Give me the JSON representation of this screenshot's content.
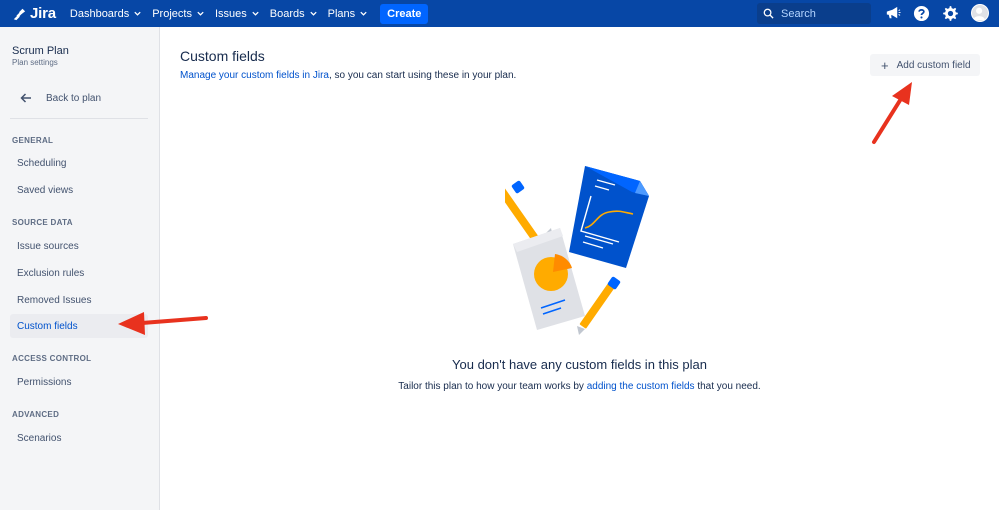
{
  "topnav": {
    "logo_text": "Jira",
    "items": [
      {
        "label": "Dashboards"
      },
      {
        "label": "Projects"
      },
      {
        "label": "Issues"
      },
      {
        "label": "Boards"
      },
      {
        "label": "Plans"
      }
    ],
    "create_label": "Create",
    "search_placeholder": "Search",
    "icons": [
      "megaphone-icon",
      "help-icon",
      "settings-icon",
      "avatar"
    ]
  },
  "sidebar": {
    "plan_title": "Scrum Plan",
    "plan_subtitle": "Plan settings",
    "back_label": "Back to plan",
    "sections": {
      "general": "GENERAL",
      "source_data": "SOURCE DATA",
      "access_control": "ACCESS CONTROL",
      "advanced": "ADVANCED"
    },
    "items": {
      "scheduling": "Scheduling",
      "saved_views": "Saved views",
      "issue_sources": "Issue sources",
      "exclusion_rules": "Exclusion rules",
      "removed_issues": "Removed Issues",
      "custom_fields": "Custom fields",
      "permissions": "Permissions",
      "scenarios": "Scenarios"
    },
    "active_item": "Custom fields"
  },
  "main": {
    "title": "Custom fields",
    "desc_link": "Manage your custom fields in Jira",
    "desc_rest": ", so you can start using these in your plan.",
    "add_button_label": "Add custom field",
    "empty_title": "You don't have any custom fields in this plan",
    "empty_desc_pre": "Tailor this plan to how your team works by ",
    "empty_desc_link": "adding the custom fields",
    "empty_desc_post": " that you need."
  },
  "colors": {
    "nav_bg": "#0747A6",
    "create_bg": "#0065FF",
    "link": "#0052CC",
    "annotation_arrow": "#E8321E"
  }
}
